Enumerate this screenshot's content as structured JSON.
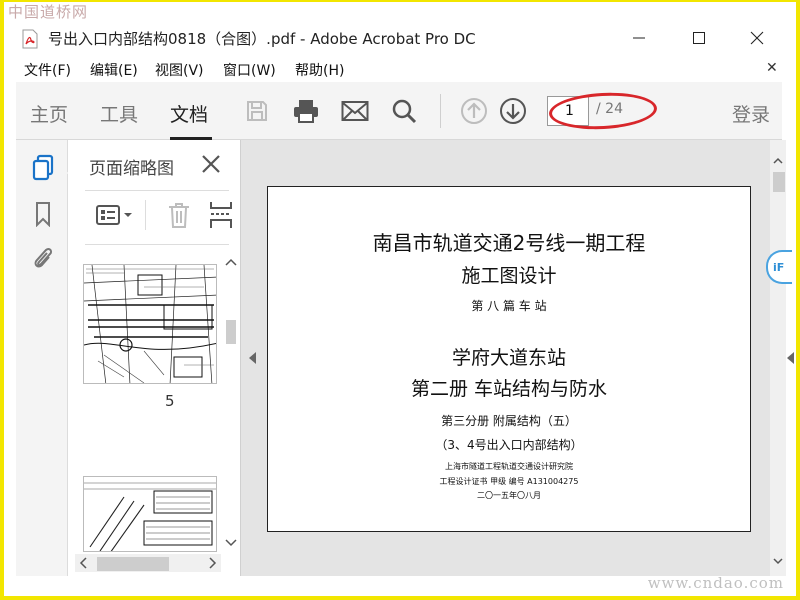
{
  "watermark_top": "中国道桥网",
  "watermark_bottom": "www.cndao.com",
  "window": {
    "title": "号出入口内部结构0818（合图）.pdf - Adobe Acrobat Pro DC"
  },
  "menu": [
    {
      "label": "文件(F)"
    },
    {
      "label": "编辑(E)"
    },
    {
      "label": "视图(V)"
    },
    {
      "label": "窗口(W)"
    },
    {
      "label": "帮助(H)"
    }
  ],
  "toolbar": {
    "tabs": [
      {
        "label": "主页"
      },
      {
        "label": "工具"
      },
      {
        "label": "文档"
      }
    ],
    "active_tab": "文档",
    "current_page": "1",
    "total_pages": "/ 24",
    "login": "登录",
    "highlight_color": "#d8262a"
  },
  "thumbnails": {
    "title": "页面缩略图",
    "visible_page_numbers": [
      "5"
    ]
  },
  "document": {
    "lines": [
      {
        "text": "南昌市轨道交通2号线一期工程"
      },
      {
        "text": "施工图设计"
      },
      {
        "text": "第 八 篇     车 站"
      },
      {
        "text": "学府大道东站"
      },
      {
        "text": "第二册  车站结构与防水"
      },
      {
        "text": "第三分册    附属结构（五）"
      },
      {
        "text": "（3、4号出入口内部结构）"
      },
      {
        "text": "上海市隧道工程轨道交通设计研究院"
      },
      {
        "text": "工程设计证书    甲级    编号   A131004275"
      },
      {
        "text": "二〇一五年〇八月"
      }
    ]
  },
  "floating_badge": "iF"
}
